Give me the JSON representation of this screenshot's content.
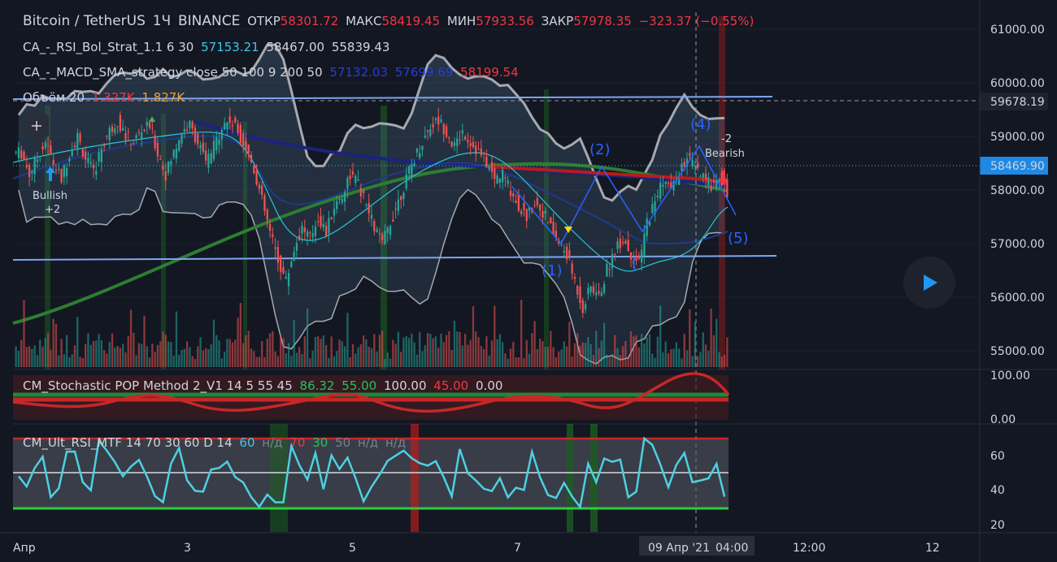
{
  "header": {
    "symbol": "Bitcoin / TetherUS",
    "timeframe": "1Ч",
    "exchange": "BINANCE",
    "open_label": "ОТКР",
    "open": "58301.72",
    "high_label": "МАКС",
    "high": "58419.45",
    "low_label": "МИН",
    "low": "57933.56",
    "close_label": "ЗАКР",
    "close": "57978.35",
    "change": "−323.37 (−0.55%)"
  },
  "indicators": {
    "rsi_bol": {
      "name": "CA_-_RSI_Bol_Strat_1.1 6 30",
      "v1": "57153.21",
      "v2": "58467.00",
      "v3": "55839.43"
    },
    "macd_sma": {
      "name": "CA_-_MACD_SMA_strategy close 50 100 9 200 50",
      "v1": "57132.03",
      "v2": "57699.69",
      "v3": "58199.54"
    },
    "volume": {
      "name": "Объём 20",
      "v1": "1.327K",
      "v2": "1.827K"
    },
    "stoch": {
      "name": "CM_Stochastic POP Method 2_V1 14 5 55 45",
      "v1": "86.32",
      "v2": "55.00",
      "v3": "100.00",
      "v4": "45.00",
      "v5": "0.00"
    },
    "ult_rsi": {
      "name": "CM_Ult_RSI_MTF 14 70 30 60 D 14",
      "v1": "60",
      "v2": "н/д",
      "v3": "70",
      "v4": "30",
      "v5": "50",
      "v6": "н/д",
      "v7": "н/д"
    }
  },
  "price_axis": {
    "ticks": [
      "61000.00",
      "60000.00",
      "59000.00",
      "58000.00",
      "57000.00",
      "56000.00",
      "55000.00"
    ],
    "crosshair_label": "59678.19",
    "last_price_label": "58469.90"
  },
  "stoch_axis": {
    "ticks": [
      "100.00",
      "0.00"
    ]
  },
  "rsi_axis": {
    "ticks": [
      "60",
      "40",
      "20"
    ]
  },
  "time_axis": {
    "ticks": [
      "Апр",
      "3",
      "5",
      "7",
      "12:00",
      "12"
    ],
    "crosshair_label": "09 Апр '21",
    "crosshair_time": "04:00"
  },
  "annotations": {
    "bullish": "Bullish",
    "bullish_count": "+2",
    "bearish": "Bearish",
    "bearish_count": "-2",
    "waves": [
      "(1)",
      "(2)",
      "(4)",
      "(5)",
      "("
    ]
  },
  "colors": {
    "background": "#131722",
    "up": "#26a69a",
    "down": "#ef5350",
    "accent_blue": "#2962ff"
  },
  "chart_data": {
    "type": "candlestick",
    "symbol": "Bitcoin / TetherUS",
    "interval": "1H",
    "ylim": [
      54800,
      61300
    ],
    "x_ticks": [
      "Апр",
      "3",
      "5",
      "7",
      "12:00",
      "12"
    ],
    "levels": {
      "resistance": 59678.19,
      "support": 56750
    },
    "last_price": 58469.9,
    "ohlc_last": {
      "open": 58301.72,
      "high": 58419.45,
      "low": 57933.56,
      "close": 57978.35
    },
    "close_series": [
      58700,
      58300,
      58600,
      58900,
      58500,
      58200,
      58700,
      59000,
      58600,
      58300,
      58800,
      59100,
      59300,
      59000,
      58900,
      59100,
      59200,
      58700,
      58300,
      58700,
      59100,
      59200,
      58900,
      58500,
      58800,
      59200,
      59300,
      59100,
      58800,
      58400,
      57800,
      57200,
      56700,
      56300,
      56900,
      57300,
      57100,
      57500,
      57200,
      57700,
      57900,
      58300,
      58100,
      57700,
      57300,
      57000,
      57400,
      57800,
      58200,
      58600,
      58900,
      59200,
      59300,
      59100,
      58800,
      59100,
      58900,
      58700,
      58500,
      58200,
      58300,
      58000,
      57700,
      57500,
      57800,
      57600,
      57300,
      57000,
      56800,
      56300,
      55800,
      56200,
      56000,
      56500,
      56900,
      57100,
      56800,
      56600,
      57400,
      57800,
      58200,
      58000,
      58300,
      58600,
      58400,
      58200,
      58100,
      58300,
      57978
    ]
  }
}
